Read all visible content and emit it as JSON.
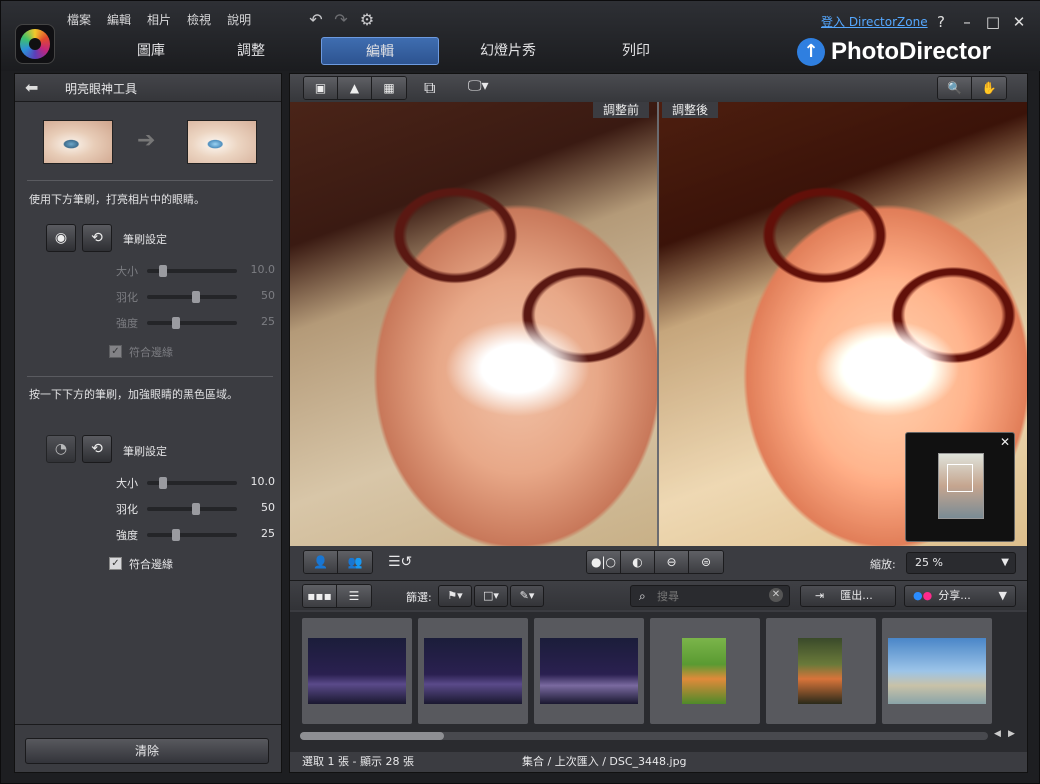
{
  "menu": [
    "檔案",
    "編輯",
    "相片",
    "檢視",
    "說明"
  ],
  "login": "登入 DirectorZone",
  "window_buttons": {
    "help": "?",
    "minimize": "–",
    "maximize": "□",
    "close": "✕"
  },
  "tabs": [
    "圖庫",
    "調整",
    "編輯",
    "幻燈片秀",
    "列印"
  ],
  "active_tab": "編輯",
  "brand": "PhotoDirector",
  "panel": {
    "title": "明亮眼神工具",
    "section1": {
      "desc": "使用下方筆刷，打亮相片中的眼睛。",
      "brush_label": "筆刷設定",
      "sliders": [
        {
          "label": "大小",
          "value": "10.0",
          "frac": 0.1
        },
        {
          "label": "羽化",
          "value": "50",
          "frac": 0.5
        },
        {
          "label": "強度",
          "value": "25",
          "frac": 0.25
        }
      ],
      "edge_label": "符合邊緣"
    },
    "section2": {
      "desc": "按一下下方的筆刷，加強眼睛的黑色區域。",
      "brush_label": "筆刷設定",
      "sliders": [
        {
          "label": "大小",
          "value": "10.0",
          "frac": 0.1
        },
        {
          "label": "羽化",
          "value": "50",
          "frac": 0.5
        },
        {
          "label": "強度",
          "value": "25",
          "frac": 0.25
        }
      ],
      "edge_label": "符合邊緣"
    },
    "clear": "清除"
  },
  "photo": {
    "before": "調整前",
    "after": "調整後"
  },
  "zoom": {
    "label": "縮放:",
    "value": "25 %"
  },
  "filter": {
    "label": "篩選:",
    "search_placeholder": "搜尋",
    "export": "匯出...",
    "share": "分享..."
  },
  "status": {
    "selection": "選取 1 張 - 顯示 28 張",
    "path": "集合 / 上次匯入 / DSC_3448.jpg"
  }
}
